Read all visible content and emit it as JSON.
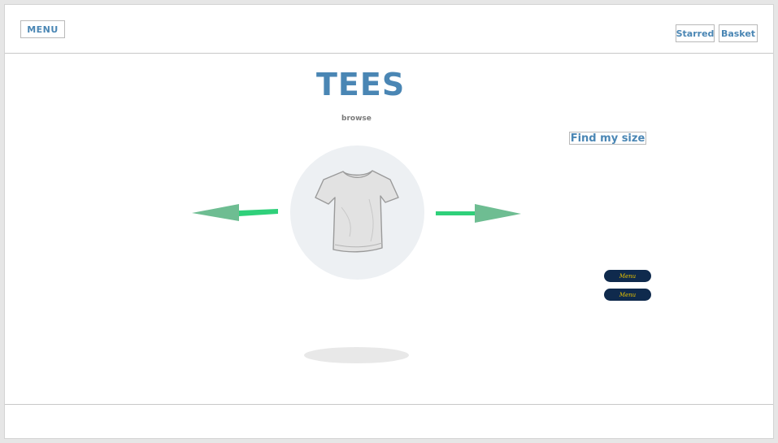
{
  "header": {
    "menu_label": "MENU",
    "starred_label": "Starred",
    "basket_label": "Basket"
  },
  "main": {
    "title": "TEES",
    "subtitle": "browse",
    "find_size_label": "Find my size",
    "pills": [
      "Menu",
      "Menu"
    ]
  },
  "colors": {
    "accent": "#4a86b4",
    "arrow_green": "#2fd07a",
    "arrow_head": "#6ebd92",
    "pill_bg": "#0f2a4d",
    "pill_text": "#e6c200"
  }
}
